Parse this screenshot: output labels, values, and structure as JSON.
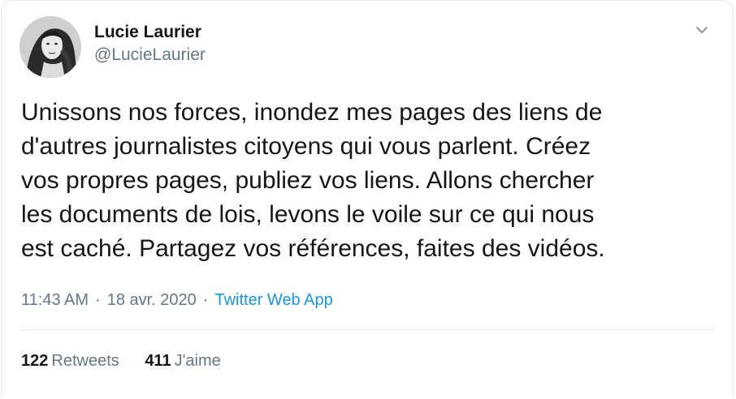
{
  "author": {
    "display_name": "Lucie Laurier",
    "handle": "@LucieLaurier"
  },
  "tweet": {
    "lines": [
      "Unissons nos forces, inondez mes pages des liens de",
      "d'autres journalistes citoyens qui vous parlent. Créez",
      "vos propres pages, publiez vos liens. Allons chercher",
      "les documents de lois, levons le voile sur ce qui nous",
      "est caché. Partagez vos références, faites des vidéos."
    ]
  },
  "meta": {
    "time": "11:43 AM",
    "separator_1": "·",
    "date": "18 avr. 2020",
    "separator_2": "·",
    "source": "Twitter Web App"
  },
  "stats": {
    "retweets_count": "122",
    "retweets_label": "Retweets",
    "likes_count": "411",
    "likes_label": "J'aime"
  },
  "icons": {
    "caret": "chevron-down-icon"
  },
  "colors": {
    "text_primary": "#14171a",
    "text_secondary": "#657786",
    "link": "#1b95e0",
    "border": "#e1e8ed"
  }
}
